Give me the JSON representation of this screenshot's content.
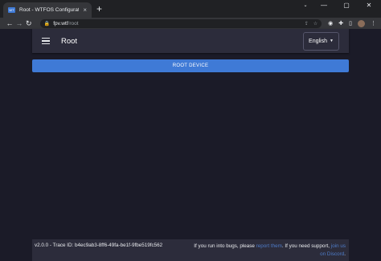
{
  "browser": {
    "tab_title": "Root - WTFOS Configurator",
    "favicon_text": "WT",
    "url_host": "fpv.wtf",
    "url_path": "/root"
  },
  "app": {
    "title": "Root",
    "language": "English",
    "root_button": "ROOT DEVICE"
  },
  "footer": {
    "version_trace": "v2.0.0 - Trace ID: b4ec9ab3-8ff6-49fa-be1f-9fbe519fc562",
    "bugs_text": "If you run into bugs, please ",
    "report_link": "report them",
    "support_text": ". If you need support, ",
    "discord_link": "join us on Discord",
    "end_text": "."
  },
  "icons": {
    "back": "arrow-left-icon",
    "forward": "arrow-right-icon",
    "reload": "reload-icon",
    "lock": "lock-icon",
    "menu": "hamburger-icon"
  },
  "colors": {
    "accent": "#3f7ad6",
    "background": "#1b1b28",
    "surface": "#2c2c3b",
    "link": "#4e7cc9"
  }
}
